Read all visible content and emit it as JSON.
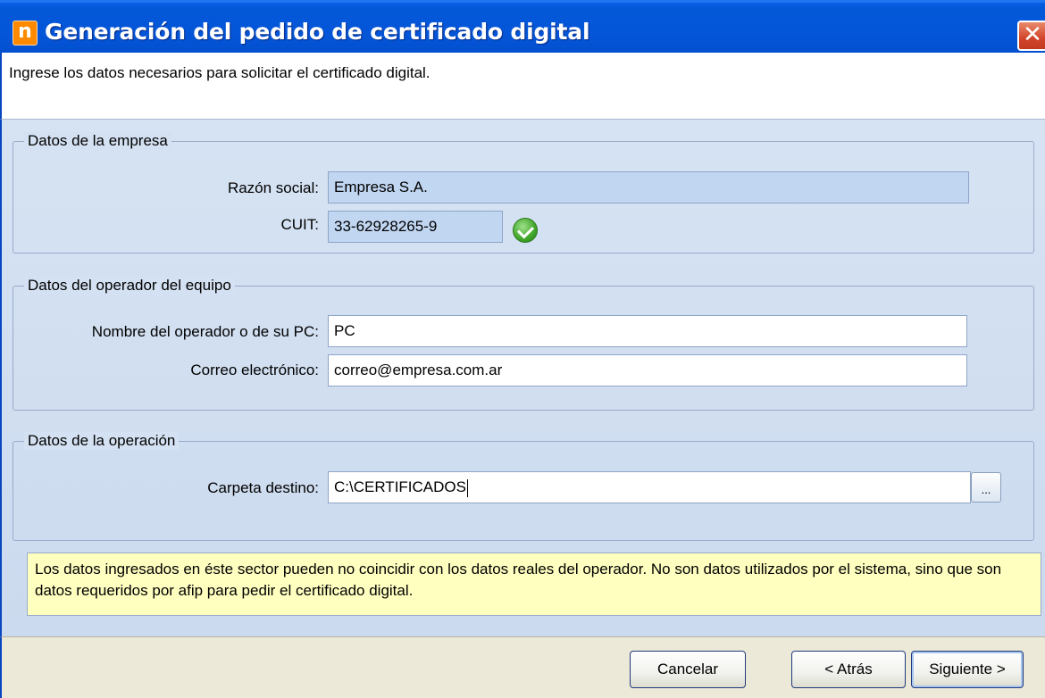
{
  "window": {
    "title": "Generación del pedido de certificado digital",
    "icon_letter": "n",
    "close_glyph": "✕"
  },
  "instruction": "Ingrese los datos necesarios para solicitar el certificado digital.",
  "empresa": {
    "legend": "Datos de la empresa",
    "razon_label": "Razón social:",
    "razon_value": "Empresa S.A.",
    "cuit_label": "CUIT:",
    "cuit_value": "33-62928265-9",
    "cuit_status_icon": "check-valid-icon"
  },
  "operador": {
    "legend": "Datos del operador del equipo",
    "nombre_label": "Nombre del operador o de su PC:",
    "nombre_value": "PC",
    "correo_label": "Correo electrónico:",
    "correo_value": "correo@empresa.com.ar"
  },
  "operacion": {
    "legend": "Datos de la operación",
    "carpeta_label": "Carpeta destino:",
    "carpeta_value": "C:\\CERTIFICADOS",
    "browse_label": "..."
  },
  "note": "Los datos ingresados en éste sector pueden no coincidir con los datos reales del operador. No son datos utilizados por el sistema, sino que son datos requeridos por afip para pedir el certificado digital.",
  "buttons": {
    "cancel": "Cancelar",
    "back": "< Atrás",
    "next": "Siguiente >"
  },
  "colors": {
    "titlebar": "#0456d9",
    "body": "#d6e3f3",
    "note_bg": "#ffffc0",
    "readonly_field": "#c0d6f1"
  }
}
